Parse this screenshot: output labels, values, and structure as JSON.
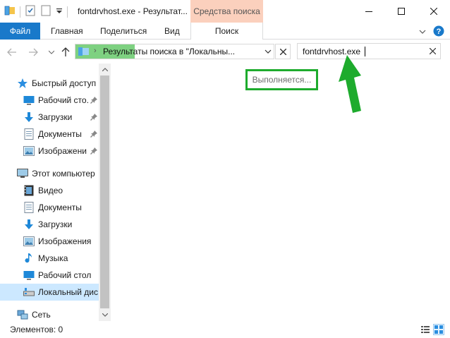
{
  "window": {
    "title": "fontdrvhost.exe - Результат...",
    "context_tab_group": "Средства поиска"
  },
  "ribbon": {
    "tabs": [
      "Файл",
      "Главная",
      "Поделиться",
      "Вид"
    ],
    "context_tab": "Поиск"
  },
  "address": {
    "path": "Результаты поиска в \"Локальны..."
  },
  "search": {
    "value": "fontdrvhost.exe"
  },
  "sidebar": {
    "quick_access": {
      "label": "Быстрый доступ",
      "items": [
        {
          "label": "Рабочий сто.",
          "icon": "desktop-icon",
          "pinned": true
        },
        {
          "label": "Загрузки",
          "icon": "download-icon",
          "pinned": true
        },
        {
          "label": "Документы",
          "icon": "document-icon",
          "pinned": true
        },
        {
          "label": "Изображени",
          "icon": "picture-icon",
          "pinned": true
        }
      ]
    },
    "this_pc": {
      "label": "Этот компьютер",
      "items": [
        {
          "label": "Видео",
          "icon": "video-icon"
        },
        {
          "label": "Документы",
          "icon": "document-icon"
        },
        {
          "label": "Загрузки",
          "icon": "download-icon"
        },
        {
          "label": "Изображения",
          "icon": "picture-icon"
        },
        {
          "label": "Музыка",
          "icon": "music-icon"
        },
        {
          "label": "Рабочий стол",
          "icon": "desktop-icon"
        },
        {
          "label": "Локальный дис",
          "icon": "drive-icon",
          "selected": true
        }
      ]
    },
    "network": {
      "label": "Сеть"
    }
  },
  "main": {
    "status_message": "Выполняется..."
  },
  "status_bar": {
    "items_label": "Элементов: 0"
  },
  "colors": {
    "file_tab": "#1979ca",
    "context_tab_header": "#fbd0bd",
    "annotation_green": "#1eab2d",
    "address_highlight": "#7ed181",
    "selected_item": "#cce8ff"
  }
}
